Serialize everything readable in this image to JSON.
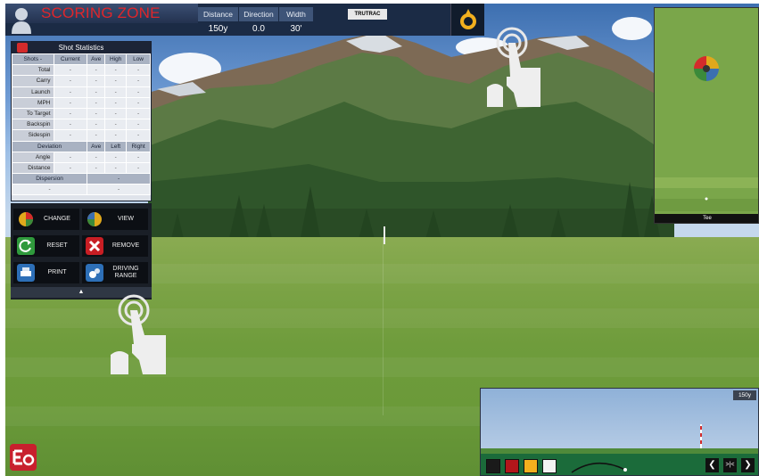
{
  "header": {
    "title": "SCORING ZONE",
    "columns": [
      {
        "label": "Distance",
        "value": "150y"
      },
      {
        "label": "Direction",
        "value": "0.0"
      },
      {
        "label": "Width",
        "value": "30'"
      }
    ],
    "brand_badge": "TRUTRAC"
  },
  "stats": {
    "title": "Shot Statistics",
    "columns": [
      "Shots -",
      "Current",
      "Ave",
      "High",
      "Low"
    ],
    "rows": [
      {
        "label": "Total",
        "values": [
          "-",
          "-",
          "-",
          "-"
        ]
      },
      {
        "label": "Carry",
        "values": [
          "-",
          "-",
          "-",
          "-"
        ]
      },
      {
        "label": "Launch",
        "values": [
          "-",
          "-",
          "-",
          "-"
        ]
      },
      {
        "label": "MPH",
        "values": [
          "-",
          "-",
          "-",
          "-"
        ]
      },
      {
        "label": "To Target",
        "values": [
          "-",
          "-",
          "-",
          "-"
        ]
      },
      {
        "label": "Backspin",
        "values": [
          "-",
          "-",
          "-",
          "-"
        ]
      },
      {
        "label": "Sidespin",
        "values": [
          "-",
          "-",
          "-",
          "-"
        ]
      }
    ],
    "deviation_columns": [
      "Deviation",
      "Ave",
      "Left",
      "Right"
    ],
    "deviation_rows": [
      {
        "label": "Angle",
        "values": [
          "-",
          "-",
          "-",
          "-"
        ]
      },
      {
        "label": "Distance",
        "values": [
          "-",
          "-",
          "-",
          "-"
        ]
      }
    ],
    "dispersion_label": "Dispersion",
    "dispersion_values": [
      "-",
      "-",
      "-"
    ]
  },
  "buttons": {
    "change": "CHANGE",
    "view": "VIEW",
    "reset": "RESET",
    "remove": "REMOVE",
    "print": "PRINT",
    "driving_range": "DRIVING RANGE",
    "collapse": "▲"
  },
  "minimap": {
    "label": "Tee"
  },
  "trajectory": {
    "distance": "150y",
    "colors": [
      "#1a1a1a",
      "#b3161b",
      "#f2b01e",
      "#f2f2f2"
    ],
    "nav": {
      "prev": "❮",
      "center": ">|<",
      "next": "❯"
    }
  },
  "icons": {
    "tap_hand": "tap-gesture-icon",
    "brand": "e6-logo-icon"
  }
}
